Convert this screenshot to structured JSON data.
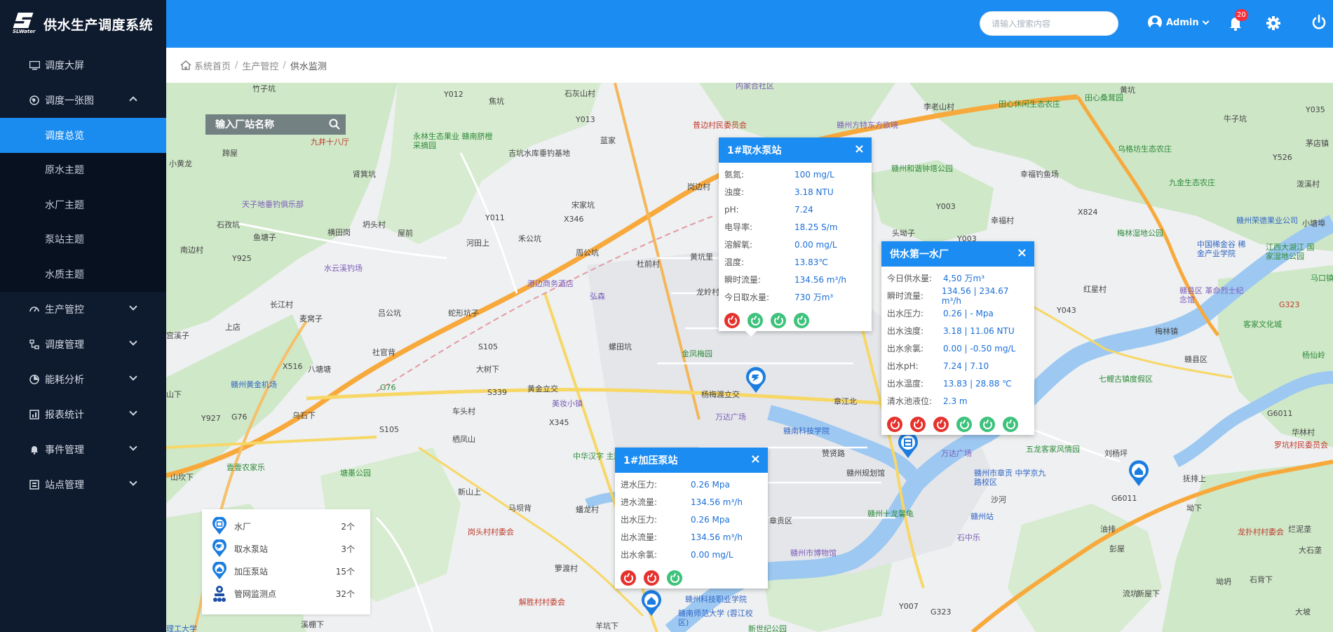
{
  "brand": {
    "title": "供水生产调度系统",
    "logo_text": "SLWater"
  },
  "sidebar": {
    "items": [
      {
        "label": "调度大屏",
        "icon": "monitor-icon"
      },
      {
        "label": "调度一张图",
        "icon": "globe-icon",
        "expanded": true
      },
      {
        "label": "生产管控",
        "icon": "dashboard-icon"
      },
      {
        "label": "调度管理",
        "icon": "flow-icon"
      },
      {
        "label": "能耗分析",
        "icon": "energy-icon"
      },
      {
        "label": "报表统计",
        "icon": "report-icon"
      },
      {
        "label": "事件管理",
        "icon": "bell-icon"
      },
      {
        "label": "站点管理",
        "icon": "station-icon"
      }
    ],
    "submenu": [
      {
        "label": "调度总览",
        "active": true
      },
      {
        "label": "原水主题"
      },
      {
        "label": "水厂主题"
      },
      {
        "label": "泵站主题"
      },
      {
        "label": "水质主题"
      }
    ]
  },
  "header": {
    "search_placeholder": "请输入搜索内容",
    "user_name": "Admin",
    "notification_count": "20"
  },
  "breadcrumb": {
    "home": "系统首页",
    "level1": "生产管控",
    "current": "供水监测"
  },
  "map": {
    "station_search_placeholder": "输入厂站名称",
    "labels": [
      "竹子坑",
      "Y012",
      "焦坑",
      "石灰山村",
      "内家合社区",
      "黄坑",
      "李老山村",
      "田心休闲生态农庄",
      "田心桑茸园",
      "牛子坑",
      "Y035",
      "茅店镇",
      "小黄龙",
      "蹄屋",
      "永林生态果业 赣南脐橙采摘园",
      "九井十八厅",
      "Y013",
      "蓝家",
      "吉坑水库垂钓基地",
      "普边村民委员会",
      "赣州方特东方欲晓",
      "乌格坊生态农庄",
      "Y526",
      "泼溪村",
      "肾箕坑",
      "天子地垂钓俱乐部",
      "宋家坑",
      "岗边村",
      "赣州和谐钟塔公园",
      "幸福钓鱼场",
      "九金生态农庄",
      "石孜坑",
      "坍头村",
      "Y011",
      "X346",
      "Y003",
      "幸福村",
      "X824",
      "赣州荣德果业公司",
      "小塘埠",
      "鱼塘子",
      "横田岗",
      "屋前",
      "禾公坑",
      "头坳子",
      "Y003",
      "梅林湿地公园",
      "南边村",
      "河田上",
      "周公坑",
      "杜前村",
      "黄坑里",
      "中国稀金谷 稀金产业学院",
      "江西大湖江 国家湿地公园",
      "Y925",
      "水云溪钓场",
      "港边商务酒店",
      "弘森",
      "龙岭村",
      "赣县区 革命烈士纪念馆",
      "马口镇",
      "长江村",
      "吕公坑",
      "蛇形坑子",
      "红星村",
      "G323",
      "Y043",
      "客家文化城",
      "上店",
      "麦窝子",
      "梅林镇",
      "宫溪子",
      "社官背",
      "S105",
      "赣县区",
      "金凤梅园",
      "杨仙岭",
      "X516",
      "八塘塘",
      "大树下",
      "螺田坑",
      "章江北",
      "七鲤古镇度假区",
      "山下",
      "赣州黄金机场",
      "G76",
      "黄金立交",
      "S339",
      "杨梅渡立交",
      "Y927",
      "乌石下",
      "车头村",
      "美妆小镇",
      "万达广场",
      "华林村",
      "S105",
      "X345",
      "赣南科技学院",
      "五龙客家风情园",
      "罗坑村民委员会",
      "G76",
      "栖凤山",
      "中华汉字 主题文化公园",
      "赞贤路",
      "万达广场",
      "赣州市章贡 中学京九路校区",
      "刘杨坪",
      "山坎下",
      "壹壹农家乐",
      "新山上",
      "塘墨公园",
      "赣州规划馆",
      "沙河",
      "抚排上",
      "G6011",
      "G6011",
      "马坝背",
      "蟠龙村",
      "章贡区",
      "赣州十龙馨龟",
      "赣州站",
      "坳下",
      "岗头村村委会",
      "石中乐",
      "油排",
      "烂泥垄",
      "龙扑村村委会",
      "赣州市博物馆",
      "彭屋",
      "大石垄",
      "箩渡村",
      "赣州科技职业学院",
      "新屋下",
      "石背下",
      "坳坍",
      "解胜村村委会",
      "赣南师范大学 (蓉江校区)",
      "流坑",
      "Y007",
      "G323",
      "大坡",
      "溪棚下",
      "羊坑下",
      "新世纪公园",
      "理工大学"
    ],
    "popups": {
      "intake": {
        "title": "1#取水泵站",
        "rows": [
          {
            "k": "氨氮:",
            "v": "100 mg/L"
          },
          {
            "k": "浊度:",
            "v": "3.18 NTU"
          },
          {
            "k": "pH:",
            "v": "7.24"
          },
          {
            "k": "电导率:",
            "v": "18.25 S/m"
          },
          {
            "k": "溶解氧:",
            "v": "0.00 mg/L"
          },
          {
            "k": "温度:",
            "v": "13.83℃"
          },
          {
            "k": "瞬时流量:",
            "v": "134.56 m³/h"
          },
          {
            "k": "今日取水量:",
            "v": "730 万m³"
          }
        ],
        "actions": [
          "red",
          "green",
          "green",
          "green"
        ]
      },
      "plant": {
        "title": "供水第一水厂",
        "rows": [
          {
            "k": "今日供水量:",
            "v": "4,50 万m³"
          },
          {
            "k": "瞬时流量:",
            "v": "134.56 | 234.67 m³/h"
          },
          {
            "k": "出水压力:",
            "v": "0.26 | - Mpa"
          },
          {
            "k": "出水浊度:",
            "v": "3.18 | 11.06 NTU"
          },
          {
            "k": "出水余氯:",
            "v": "0.00 | -0.50 mg/L"
          },
          {
            "k": "出水pH:",
            "v": "7.24 | 7.10"
          },
          {
            "k": "出水温度:",
            "v": "13.83 | 28.88 ℃"
          },
          {
            "k": "清水池液位:",
            "v": "2.3 m"
          }
        ],
        "actions": [
          "red",
          "red",
          "red",
          "green",
          "green",
          "green"
        ]
      },
      "booster": {
        "title": "1#加压泵站",
        "rows": [
          {
            "k": "进水压力:",
            "v": "0.26 Mpa"
          },
          {
            "k": "进水流量:",
            "v": "134.56 m³/h"
          },
          {
            "k": "出水压力:",
            "v": "0.26 Mpa"
          },
          {
            "k": "出水流量:",
            "v": "134.56 m³/h"
          },
          {
            "k": "出水余氯:",
            "v": "0.00 mg/L"
          }
        ],
        "actions": [
          "red",
          "red",
          "green"
        ]
      }
    },
    "legend": [
      {
        "name": "水厂",
        "count": "2个",
        "icon": "water-plant-icon"
      },
      {
        "name": "取水泵站",
        "count": "3个",
        "icon": "intake-pump-icon"
      },
      {
        "name": "加压泵站",
        "count": "15个",
        "icon": "booster-pump-icon"
      },
      {
        "name": "管网监测点",
        "count": "32个",
        "icon": "pipe-monitor-icon"
      }
    ]
  },
  "colors": {
    "primary": "#1b8cf2",
    "sidebar": "#0e1a2d",
    "alarm": "#e5322d",
    "ok": "#3ec27c"
  }
}
